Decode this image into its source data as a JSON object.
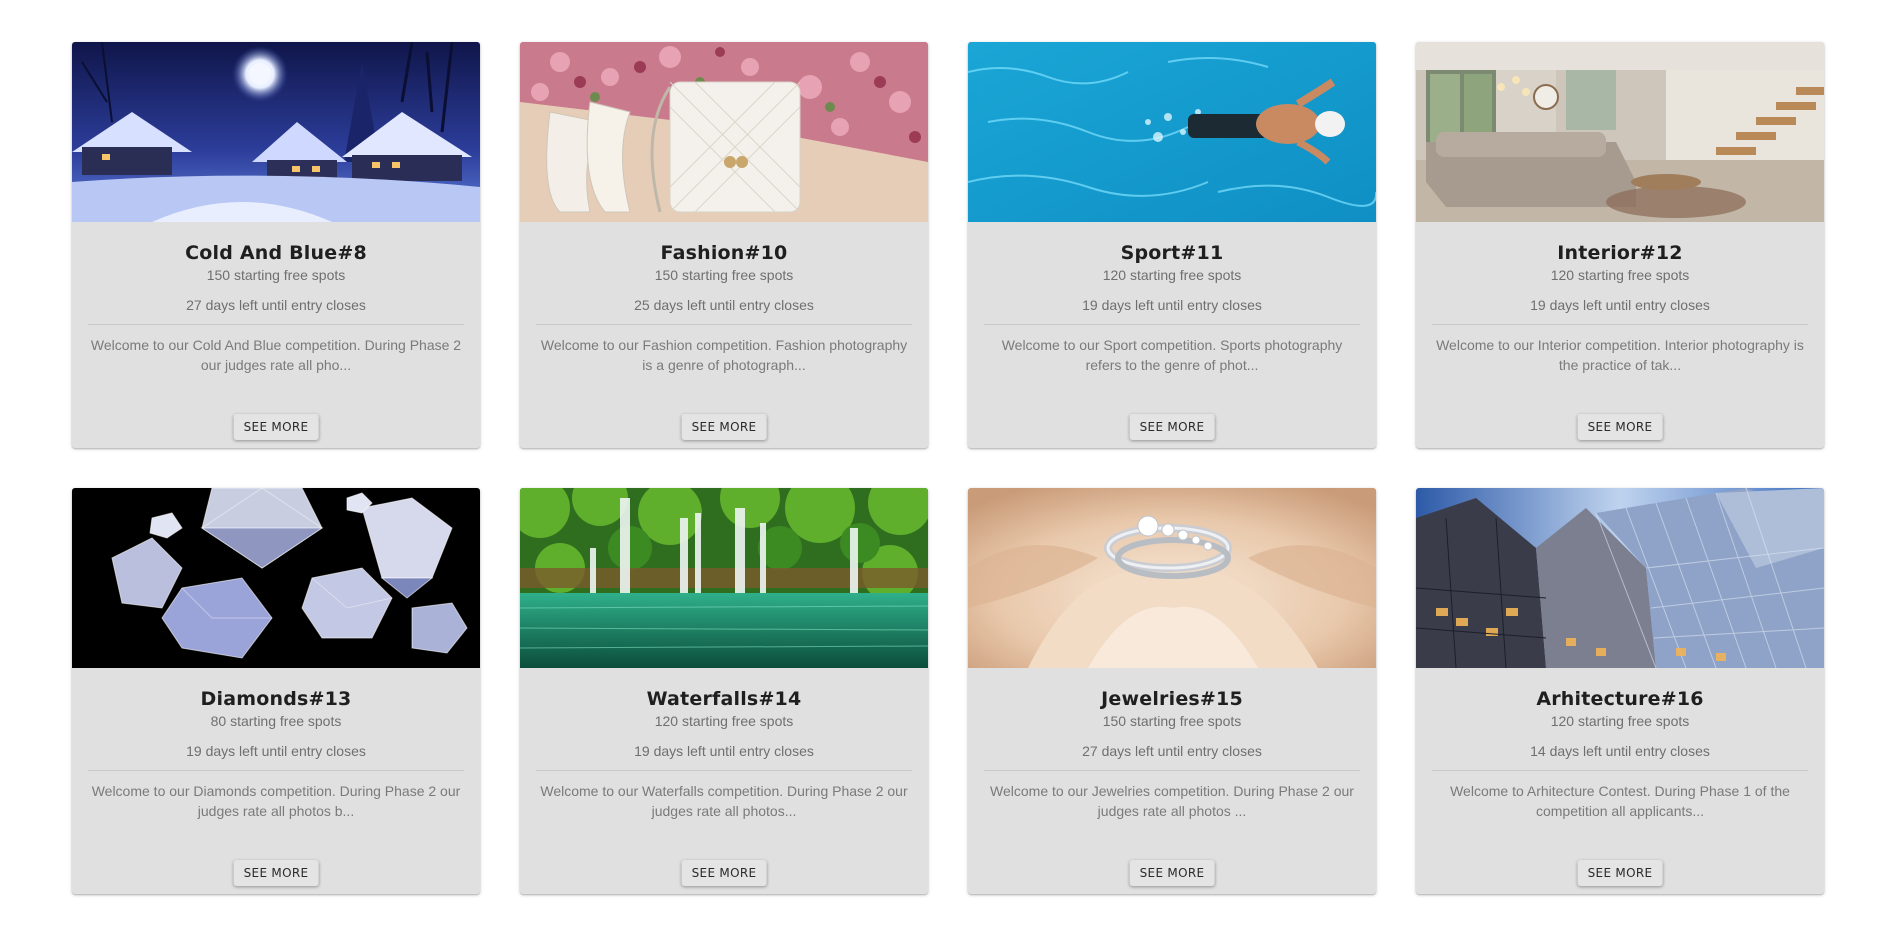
{
  "button_label": "SEE MORE",
  "cards": [
    {
      "title": "Cold And Blue#8",
      "spots": "150 starting free spots",
      "days": "27 days left until entry closes",
      "description": "Welcome to our Cold And Blue competition. During Phase 2 our judges rate all pho...",
      "image": "snowy-village-night-photo"
    },
    {
      "title": "Fashion#10",
      "spots": "150 starting free spots",
      "days": "25 days left until entry closes",
      "description": "Welcome to our Fashion competition. Fashion photography is a genre of photograph...",
      "image": "white-handbag-heels-photo"
    },
    {
      "title": "Sport#11",
      "spots": "120 starting free spots",
      "days": "19 days left until entry closes",
      "description": "Welcome to our Sport competition. Sports photography refers to the genre of phot...",
      "image": "swimmer-pool-photo"
    },
    {
      "title": "Interior#12",
      "spots": "120 starting free spots",
      "days": "19 days left until entry closes",
      "description": "Welcome to our Interior competition. Interior photography is the practice of tak...",
      "image": "living-room-interior-photo"
    },
    {
      "title": "Diamonds#13",
      "spots": "80 starting free spots",
      "days": "19 days left until entry closes",
      "description": "Welcome to our Diamonds competition. During Phase 2 our judges rate all photos b...",
      "image": "diamonds-black-background-photo"
    },
    {
      "title": "Waterfalls#14",
      "spots": "120 starting free spots",
      "days": "19 days left until entry closes",
      "description": "Welcome to our Waterfalls competition. During Phase 2 our judges rate all photos...",
      "image": "waterfalls-lake-photo"
    },
    {
      "title": "Jewelries#15",
      "spots": "150 starting free spots",
      "days": "27 days left until entry closes",
      "description": "Welcome to our Jewelries competition. During Phase 2 our judges rate all photos ...",
      "image": "ring-on-rose-photo"
    },
    {
      "title": "Arhitecture#16",
      "spots": "120 starting free spots",
      "days": "14 days left until entry closes",
      "description": "Welcome to Arhitecture Contest. During Phase 1 of the competition all applicants...",
      "image": "glass-building-photo"
    }
  ]
}
